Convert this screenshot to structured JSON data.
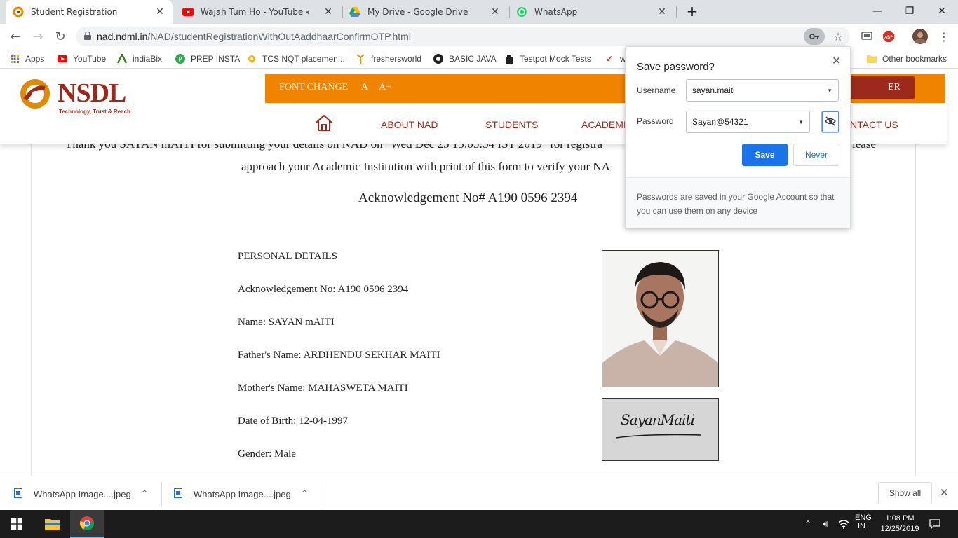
{
  "browser": {
    "tabs": [
      {
        "title": "Student Registration",
        "active": true
      },
      {
        "title": "Wajah Tum Ho - YouTube",
        "active": false
      },
      {
        "title": "My Drive - Google Drive",
        "active": false
      },
      {
        "title": "WhatsApp",
        "active": false
      }
    ],
    "url_host": "nad.ndml.in",
    "url_path": "/NAD/studentRegistrationWithOutAaddhaarConfirmOTP.html",
    "bookmarks": [
      "Apps",
      "YouTube",
      "indiaBix",
      "PREP INSTA",
      "TCS NQT placemen...",
      "freshersworld",
      "BASIC JAVA",
      "Testpot Mock Tests",
      "w"
    ],
    "other_bookmarks": "Other bookmarks"
  },
  "site": {
    "logo_name": "NSDL",
    "logo_tagline": "Technology, Trust & Reach",
    "font_change": "FONT CHANGE",
    "font_a": "A",
    "font_a_plus": "A+",
    "register_label": "ER",
    "nav": [
      "ABOUT NAD",
      "STUDENTS",
      "ACADEMI",
      "NTACT US"
    ]
  },
  "content": {
    "thanks_line1": "Thank you SAYAN mAITI for submitting your details on NAD on \"Wed Dec 25 13:05:54 IST 2019\" for registra",
    "thanks_line1_end": "lease",
    "thanks_line2": "approach your Academic Institution with print of this form to verify your NA",
    "ack_heading": "Acknowledgement No# A190 0596 2394",
    "personal_details": "PERSONAL DETAILS",
    "fields": [
      "Acknowledgement No: A190 0596 2394",
      "Name: SAYAN mAITI",
      "Father's Name: ARDHENDU SEKHAR MAITI",
      "Mother's Name: MAHASWETA MAITI",
      "Date of Birth: 12-04-1997",
      "Gender: Male"
    ],
    "signature_text": "SayanMaiti"
  },
  "password_bubble": {
    "title": "Save password?",
    "username_label": "Username",
    "username_value": "sayan.maiti",
    "password_label": "Password",
    "password_value": "Sayan@54321",
    "save_label": "Save",
    "never_label": "Never",
    "footer": "Passwords are saved in your Google Account so that you can use them on any device"
  },
  "downloads": {
    "items": [
      "WhatsApp Image....jpeg",
      "WhatsApp Image....jpeg"
    ],
    "show_all": "Show all"
  },
  "taskbar": {
    "lang1": "ENG",
    "lang2": "IN",
    "time": "1:08 PM",
    "date": "12/25/2019"
  },
  "colors": {
    "orange": "#f08300",
    "maroon": "#9c2a1c",
    "chrome_blue": "#1a73e8"
  }
}
